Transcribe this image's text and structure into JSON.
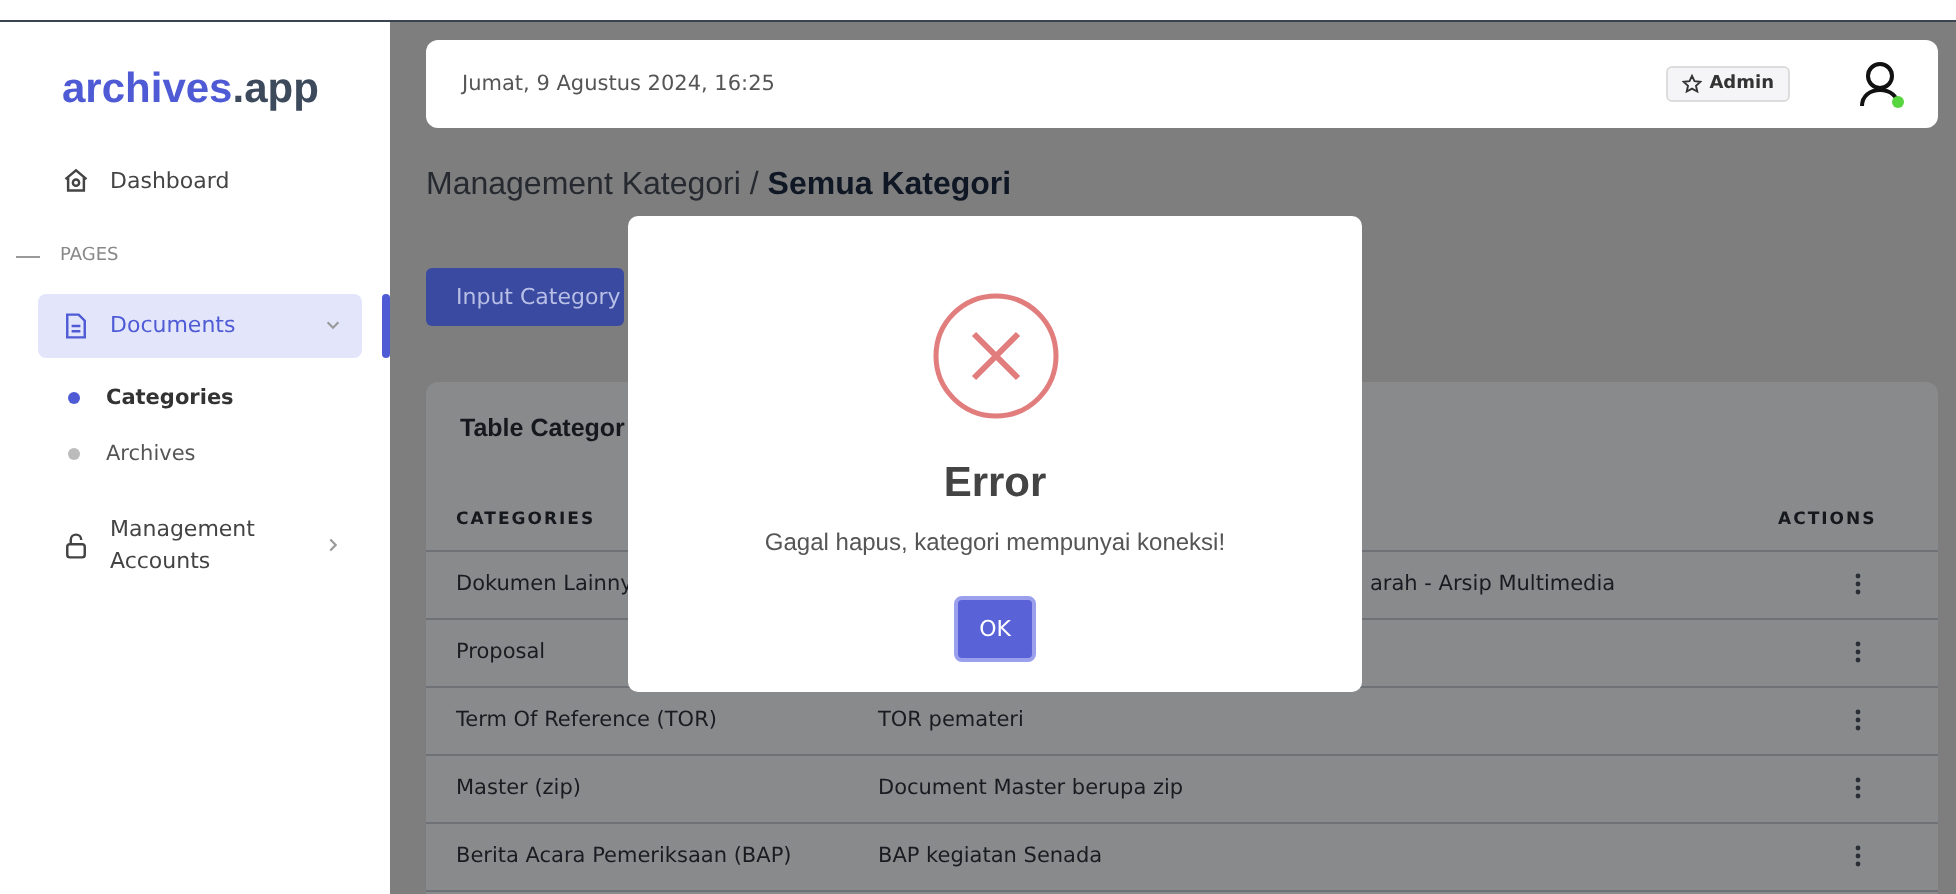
{
  "logo": {
    "primary": "archives",
    "secondary": ".app"
  },
  "sidebar": {
    "items": [
      {
        "kind": "link",
        "label": "Dashboard",
        "selected": false
      },
      {
        "kind": "section",
        "label": "PAGES"
      },
      {
        "kind": "group",
        "label": "Documents",
        "selected": true,
        "expanded": true,
        "children": [
          {
            "label": "Categories",
            "selected": true
          },
          {
            "label": "Archives",
            "selected": false
          }
        ]
      },
      {
        "kind": "group",
        "label": "Management Accounts",
        "selected": false,
        "expanded": false
      }
    ]
  },
  "header": {
    "datetime": "Jumat, 9 Agustus 2024, 16:25",
    "role_badge": "Admin",
    "online": true
  },
  "page": {
    "breadcrumb_parent": "Management Kategori /",
    "breadcrumb_current": "Semua Kategori",
    "primary_button": "Input Category"
  },
  "table": {
    "title": "Table Categor",
    "columns": [
      "CATEGORIES",
      "ACTIONS"
    ],
    "rows": [
      {
        "category": "Dokumen Lainny",
        "description": "arah - Arsip Multimedia"
      },
      {
        "category": "Proposal"
      },
      {
        "category": "Term Of Reference (TOR)",
        "description": "TOR pemateri"
      },
      {
        "category": "Master (zip)",
        "description": "Document Master berupa zip"
      },
      {
        "category": "Berita Acara Pemeriksaan (BAP)",
        "description": "BAP kegiatan Senada"
      }
    ]
  },
  "dialog": {
    "title": "Error",
    "message": "Gagal hapus, kategori mempunyai koneksi!",
    "button": "OK"
  }
}
